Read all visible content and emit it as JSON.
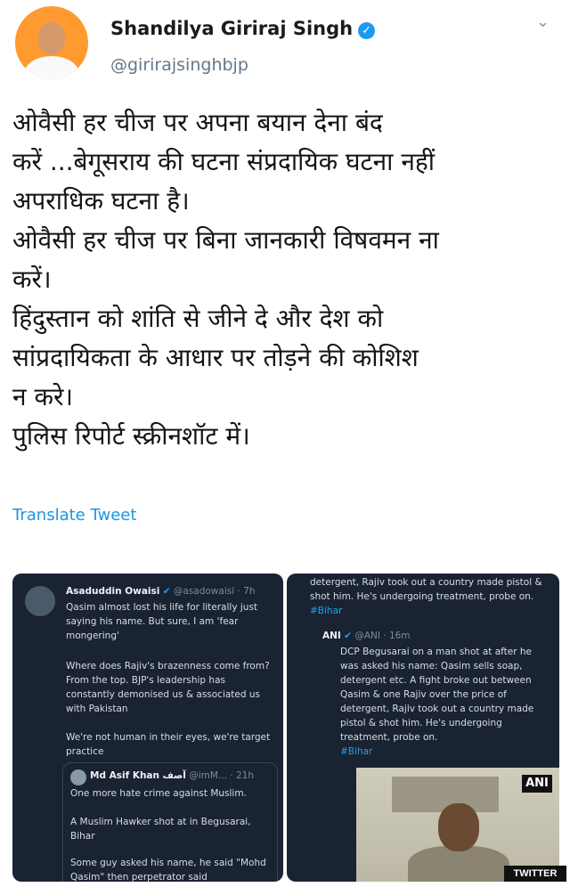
{
  "author": {
    "name": "Shandilya Giriraj Singh",
    "handle": "@girirajsinghbjp",
    "verified_icon": "verified-check-icon"
  },
  "tweet": {
    "lines": [
      "ओवैसी हर चीज पर अपना बयान देना बंद",
      "करें ...बेगूसराय की घटना संप्रदायिक घटना नहीं",
      "अपराधिक घटना है।",
      "ओवैसी हर चीज पर बिना जानकारी विषवमन ना",
      "करें।",
      "हिंदुस्तान को शांति से जीने दे और देश को",
      "सांप्रदायिकता के आधार पर तोड़ने की कोशिश",
      "न करे।",
      "पुलिस रिपोर्ट स्क्रीनशॉट में।"
    ],
    "translate_label": "Translate Tweet"
  },
  "left_screenshot": {
    "author_name": "Asaduddin Owaisi",
    "author_meta": "@asadowaisi · 7h",
    "body_1": "Qasim almost lost his life for literally just saying his name. But sure, I am 'fear mongering'",
    "body_2": "Where does Rajiv's brazenness come from? From the top. BJP's leadership has constantly demonised us & associated us with Pakistan",
    "body_3": "We're not human in their eyes, we're target practice",
    "quoted_name": "Md Asif Khan آصف",
    "quoted_meta": "@imM... · 21h",
    "quoted_1": "One more hate crime against Muslim.",
    "quoted_2": "A Muslim Hawker shot at in Begusarai, Bihar",
    "quoted_3": "Some guy asked his name, he said \"Mohd Qasim\" then perpetrator said"
  },
  "right_screenshot": {
    "top_text": "detergent, Rajiv took out a country made pistol & shot him. He's undergoing treatment, probe on.",
    "top_hashtag": "#Bihar",
    "author_name": "ANI",
    "author_meta": "@ANI · 16m",
    "body": "DCP Begusarai on a man shot at after he was asked his name: Qasim sells soap, detergent etc. A fight broke out between Qasim & one Rajiv over the price of detergent, Rajiv took out a country made pistol & shot him. He's undergoing treatment, probe on.",
    "hashtag": "#Bihar",
    "photo_badge": "ANI"
  },
  "watermark": "TWITTER"
}
